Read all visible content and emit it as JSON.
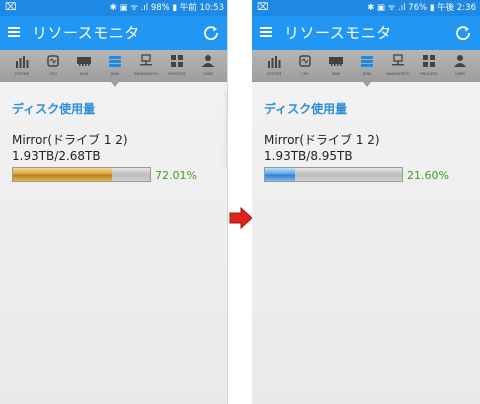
{
  "screens": [
    {
      "status": {
        "left_icon": "⌧",
        "right": "✱ ▣ ᯤ .ıl 98% ▮ 午前 10:53"
      },
      "title": "リソースモニタ",
      "tabs": [
        "SYSTEM",
        "CPU",
        "RAM",
        "DISK",
        "BANDWIDTH",
        "PROCESS",
        "USER"
      ],
      "active_tab": "DISK",
      "section_title": "ディスク使用量",
      "disk_name": "Mirror(ドライブ 1 2)",
      "disk_usage": "1.93TB/2.68TB",
      "percent_label": "72.01%",
      "percent": 0.7201,
      "bar_color": "#d9a43a"
    },
    {
      "status": {
        "left_icon": "⌧",
        "right": "✱ ▣ ᯤ .ıl 76% ▮ 午後 2:36"
      },
      "title": "リソースモニタ",
      "tabs": [
        "SYSTEM",
        "CPU",
        "RAM",
        "DISK",
        "BANDWIDTH",
        "PROCESS",
        "USER"
      ],
      "active_tab": "DISK",
      "section_title": "ディスク使用量",
      "disk_name": "Mirror(ドライブ 1 2)",
      "disk_usage": "1.93TB/8.95TB",
      "percent_label": "21.60%",
      "percent": 0.216,
      "bar_color": "#2f7fcc"
    }
  ],
  "arrow_color": "#e0241b",
  "accent_color": "#2196f3",
  "percent_color": "#3aa020"
}
